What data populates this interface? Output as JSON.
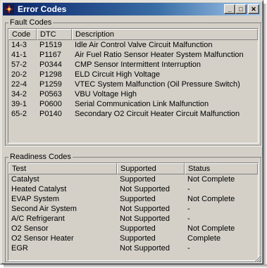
{
  "window": {
    "title": "Error Codes",
    "minimize_glyph": "_",
    "maximize_glyph": "□",
    "close_glyph": "✕"
  },
  "fault": {
    "label": "Fault Codes",
    "columns": [
      "Code",
      "DTC",
      "Description"
    ],
    "rows": [
      [
        "14-3",
        "P1519",
        "Idle Air Control Valve Circuit Malfunction"
      ],
      [
        "41-1",
        "P1167",
        "Air Fuel Ratio Sensor Heater System Malfunction"
      ],
      [
        "57-2",
        "P0344",
        "CMP Sensor Intermittent Interruption"
      ],
      [
        "20-2",
        "P1298",
        "ELD Circuit High Voltage"
      ],
      [
        "22-4",
        "P1259",
        "VTEC System Malfunction (Oil Pressure Switch)"
      ],
      [
        "34-2",
        "P0563",
        "VBU Voltage High"
      ],
      [
        "39-1",
        "P0600",
        "Serial Communication Link Malfunction"
      ],
      [
        "65-2",
        "P0140",
        "Secondary O2 Circuit Heater Circuit Malfunction"
      ]
    ]
  },
  "readiness": {
    "label": "Readiness Codes",
    "columns": [
      "Test",
      "Supported",
      "Status"
    ],
    "rows": [
      [
        "Catalyst",
        "Supported",
        "Not Complete"
      ],
      [
        "Heated Catalyst",
        "Not Supported",
        "-"
      ],
      [
        "EVAP System",
        "Supported",
        "Not Complete"
      ],
      [
        "Second Air System",
        "Not Supported",
        "-"
      ],
      [
        "A/C Refrigerant",
        "Not Supported",
        "-"
      ],
      [
        "O2 Sensor",
        "Supported",
        "Not Complete"
      ],
      [
        "O2 Sensor Heater",
        "Supported",
        "Complete"
      ],
      [
        "EGR",
        "Not Supported",
        "-"
      ]
    ]
  }
}
